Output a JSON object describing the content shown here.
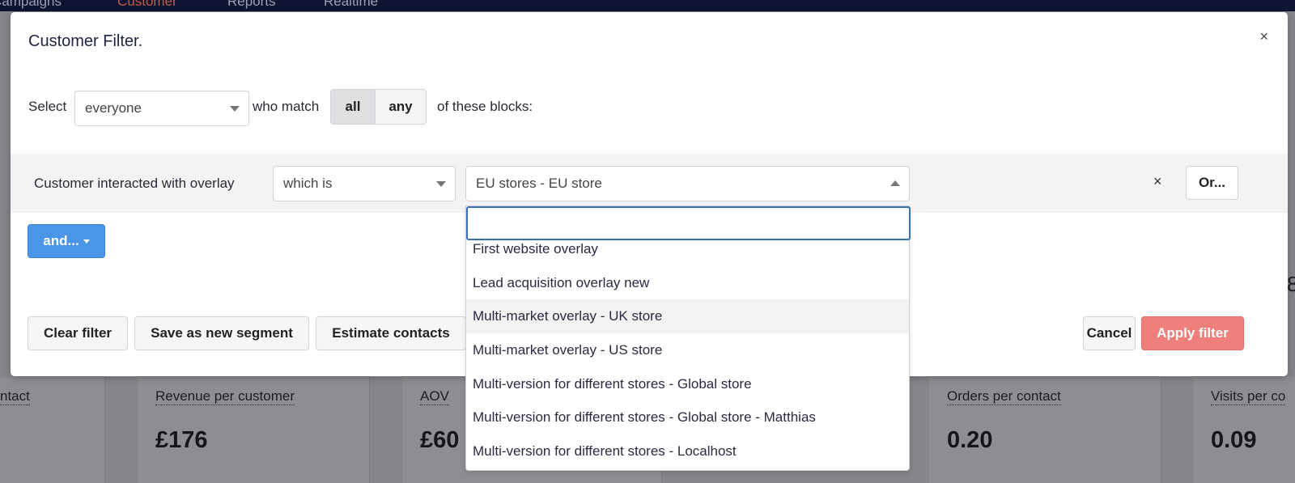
{
  "topnav": {
    "items": [
      {
        "label": "Campaigns"
      },
      {
        "label": "Customer"
      },
      {
        "label": "Reports"
      },
      {
        "label": "Realtime"
      }
    ]
  },
  "stats": [
    {
      "label": "ntact",
      "value": ""
    },
    {
      "label": "Revenue per customer",
      "value": "£176"
    },
    {
      "label": "AOV",
      "value": "£60"
    },
    {
      "label": "Orders per contact",
      "value": "0.20"
    },
    {
      "label": "Visits per co",
      "value": "0.09"
    }
  ],
  "bg_edge_char": "8",
  "modal": {
    "title": "Customer Filter.",
    "close": "×",
    "select_label": "Select",
    "audience_value": "everyone",
    "match_label": "who match",
    "match_all": "all",
    "match_any": "any",
    "blocks_label": "of these blocks:"
  },
  "block": {
    "condition_label": "Customer interacted with overlay",
    "operator_value": "which is",
    "overlay_value": "EU stores - EU store",
    "remove": "×",
    "or_button": "Or..."
  },
  "and_button": "and...",
  "footer": {
    "clear": "Clear filter",
    "save": "Save as new segment",
    "estimate": "Estimate contacts",
    "cancel": "Cancel",
    "apply": "Apply filter"
  },
  "dropdown": {
    "search_value": "",
    "options": [
      {
        "label": "First website overlay",
        "highlighted": false
      },
      {
        "label": "Lead acquisition overlay new",
        "highlighted": false
      },
      {
        "label": "Multi-market overlay - UK store",
        "highlighted": true
      },
      {
        "label": "Multi-market overlay - US store",
        "highlighted": false
      },
      {
        "label": "Multi-version for different stores - Global store",
        "highlighted": false
      },
      {
        "label": "Multi-version for different stores - Global store - Matthias",
        "highlighted": false
      },
      {
        "label": "Multi-version for different stores - Localhost",
        "highlighted": false
      }
    ]
  },
  "colors": {
    "primary": "#4a95e6",
    "apply": "#ee7f7a",
    "nav_bg": "#0f1430",
    "nav_active": "#c25a4c"
  }
}
